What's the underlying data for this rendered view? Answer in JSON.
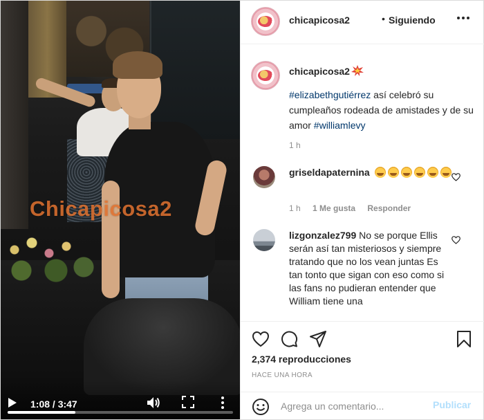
{
  "video": {
    "watermark": "Chicapicosa2",
    "time": "1:08 / 3:47",
    "progress": 0.3,
    "icons": [
      "play-icon",
      "volume-icon",
      "fullscreen-icon",
      "more-vertical-icon"
    ]
  },
  "header": {
    "username": "chicapicosa2",
    "separator": "•",
    "follow_status": "Siguiendo",
    "more_icon": "more-horizontal-icon"
  },
  "caption": {
    "username": "chicapicosa2",
    "emoji_icon": "collision-icon",
    "hashtag_start": "#elizabethgutiérrez",
    "text": " así celebró su cumpleaños rodeada de amistades y de su amor ",
    "hashtag_end": "#williamlevy",
    "time": "1 h"
  },
  "comments": [
    {
      "username": "griseldapaternina",
      "text": "",
      "emoji_count": 6,
      "time": "1 h",
      "likes": "1 Me gusta",
      "reply": "Responder"
    },
    {
      "username": "lizgonzalez799",
      "text": "No se porque Ellis serán así tan misteriosos y siempre tratando que no los vean juntas Es tan tonto que sigan con eso como si las fans no pudieran entender que William tiene una"
    }
  ],
  "actions": {
    "views": "2,374 reproducciones",
    "posted": "HACE UNA HORA",
    "icons": [
      "heart-icon",
      "comment-icon",
      "share-icon",
      "bookmark-icon"
    ]
  },
  "add_comment": {
    "placeholder": "Agrega un comentario...",
    "post_label": "Publicar"
  },
  "colors": {
    "hashtag": "#00376b",
    "muted": "#8e8e8e",
    "post_disabled": "#b2dffc",
    "watermark": "#ec7832"
  }
}
